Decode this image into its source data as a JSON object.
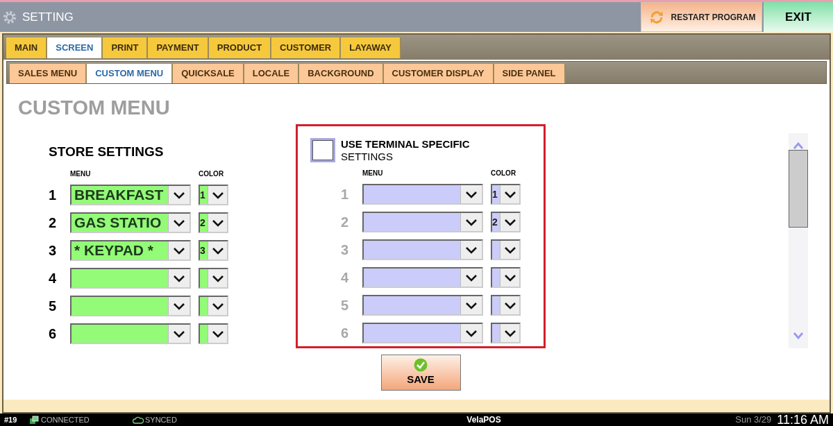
{
  "window": {
    "title": "SETTING"
  },
  "header_buttons": [
    {
      "kind": "restart",
      "label": "RESTART PROGRAM"
    },
    {
      "kind": "exit",
      "label": "EXIT"
    }
  ],
  "tabs": [
    {
      "label": "MAIN",
      "selected": false
    },
    {
      "label": "SCREEN",
      "selected": true
    },
    {
      "label": "PRINT",
      "selected": false
    },
    {
      "label": "PAYMENT",
      "selected": false
    },
    {
      "label": "PRODUCT",
      "selected": false
    },
    {
      "label": "CUSTOMER",
      "selected": false
    },
    {
      "label": "LAYAWAY",
      "selected": false
    }
  ],
  "subtabs": [
    {
      "label": "SALES MENU",
      "selected": false
    },
    {
      "label": "CUSTOM MENU",
      "selected": true
    },
    {
      "label": "QUICKSALE",
      "selected": false
    },
    {
      "label": "LOCALE",
      "selected": false
    },
    {
      "label": "BACKGROUND",
      "selected": false
    },
    {
      "label": "CUSTOMER DISPLAY",
      "selected": false
    },
    {
      "label": "SIDE PANEL",
      "selected": false
    }
  ],
  "page_title": "CUSTOM MENU",
  "store_settings": {
    "title": "STORE SETTINGS",
    "menu_header": "MENU",
    "color_header": "COLOR",
    "rows": [
      {
        "number": "1",
        "menu": "BREAKFAST",
        "color_number": "1"
      },
      {
        "number": "2",
        "menu": "GAS STATIO",
        "color_number": "2"
      },
      {
        "number": "3",
        "menu": "* KEYPAD *",
        "color_number": "3"
      },
      {
        "number": "4"
      },
      {
        "number": "5"
      },
      {
        "number": "6"
      }
    ]
  },
  "terminal_settings": {
    "checkbox": {
      "label_bold": "USE TERMINAL SPECIFIC",
      "label": "SETTINGS",
      "checked": false
    },
    "menu_header": "MENU",
    "color_header": "COLOR",
    "disabled": true,
    "rows": [
      {
        "number": "1",
        "color_number": "1"
      },
      {
        "number": "2",
        "color_number": "2"
      },
      {
        "number": "3"
      },
      {
        "number": "4"
      },
      {
        "number": "5"
      },
      {
        "number": "6"
      }
    ]
  },
  "save_button": {
    "label": "SAVE"
  },
  "status_bar": {
    "terminal": "#19",
    "connection": "CONNECTED",
    "sync": "SYNCED",
    "app_name": "VelaPOS",
    "date": "Sun 3/29",
    "time": "11:16 AM"
  }
}
